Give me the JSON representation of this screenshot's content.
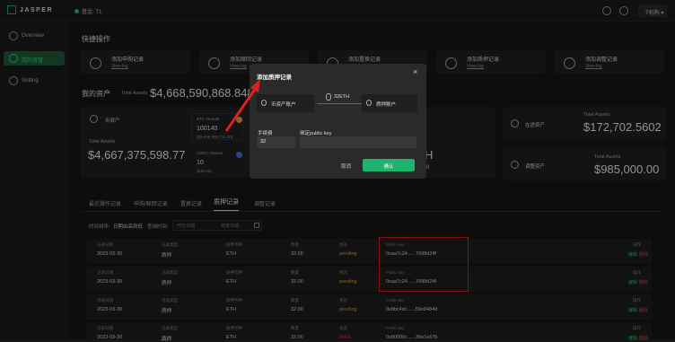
{
  "app": {
    "logo": "JASPER",
    "network": "基金: T1",
    "account": "T机构"
  },
  "sidebar": {
    "items": [
      {
        "label": "Overview"
      },
      {
        "label": "我的资管"
      },
      {
        "label": "Setting"
      }
    ]
  },
  "quick": {
    "title": "快捷操作",
    "items": [
      {
        "title": "添加申购记录",
        "link": "View log"
      },
      {
        "title": "添加赎回记录",
        "link": "View log"
      },
      {
        "title": "添加置换记录",
        "link": ""
      },
      {
        "title": "添加质押记录",
        "link": "View log"
      },
      {
        "title": "添加调整记录",
        "link": "View log"
      }
    ]
  },
  "assets": {
    "title": "我的资产",
    "total_label": "Total Assets",
    "total_value": "$4,668,590,868.848",
    "coin": {
      "title": "币资产",
      "total_label": "Total Assets",
      "total_value": "$4,667,375,598.77",
      "btc_label": "BTC Amount",
      "btc_amount": "100140",
      "btc_usd": "($2,868,505,711.30)",
      "usdc_label": "USDC Amount",
      "usdc_amount": "10",
      "usdc_usd": "($10.00)"
    },
    "hidden_partial": "H",
    "hidden_partial2": "0",
    "transit": {
      "title": "在途资产",
      "total_label": "Total Assets",
      "total_value": "$172,702.5602"
    },
    "adjust": {
      "title": "调整资产",
      "total_label": "Total Assets",
      "total_value": "$985,000.00"
    }
  },
  "tabs": [
    "最近操作记录",
    "申购/赎回记录",
    "置换记录",
    "质押记录",
    "调整记录"
  ],
  "filter": {
    "order_label": "时间排序:",
    "order_value": "日期由高到低",
    "range_label": "查询时间:",
    "start_placeholder": "开始日期",
    "end_placeholder": "结束日期"
  },
  "table": {
    "headers": [
      "记录日期",
      "记录类型",
      "质押币种",
      "数量",
      "状态",
      "Public key",
      "操作"
    ],
    "rows": [
      {
        "date": "2023-03-30",
        "type": "质押",
        "coin": "ETH",
        "qty": "32.00",
        "status": "pending",
        "key": "0xaa7c24......7698d24f",
        "edit": "编辑",
        "del": "删除"
      },
      {
        "date": "2023-03-30",
        "type": "质押",
        "coin": "ETH",
        "qty": "32.00",
        "status": "pending",
        "key": "0xaa7c24......7698d24f",
        "edit": "编辑",
        "del": "删除"
      },
      {
        "date": "2023-03-30",
        "type": "质押",
        "coin": "ETH",
        "qty": "32.00",
        "status": "pending",
        "key": "0x8bc4dc......59e8484d",
        "edit": "编辑",
        "del": "删除"
      },
      {
        "date": "2023-03-30",
        "type": "质押",
        "coin": "ETH",
        "qty": "32.00",
        "status": "finish",
        "key": "0x80000c......36e1e67b",
        "edit": "编辑",
        "del": "删除"
      }
    ]
  },
  "modal": {
    "title": "添加质押记录",
    "from": "币资产账户",
    "amount": "32ETH",
    "to": "质押账户",
    "fee_label": "手续费",
    "fee_value": "32",
    "key_label": "绑定public key",
    "key_value": "",
    "cancel": "取消",
    "confirm": "确认"
  },
  "colors": {
    "accent": "#27c17a",
    "pending": "#e7a23a",
    "danger": "#d94a4a",
    "highlight": "#e02020"
  }
}
